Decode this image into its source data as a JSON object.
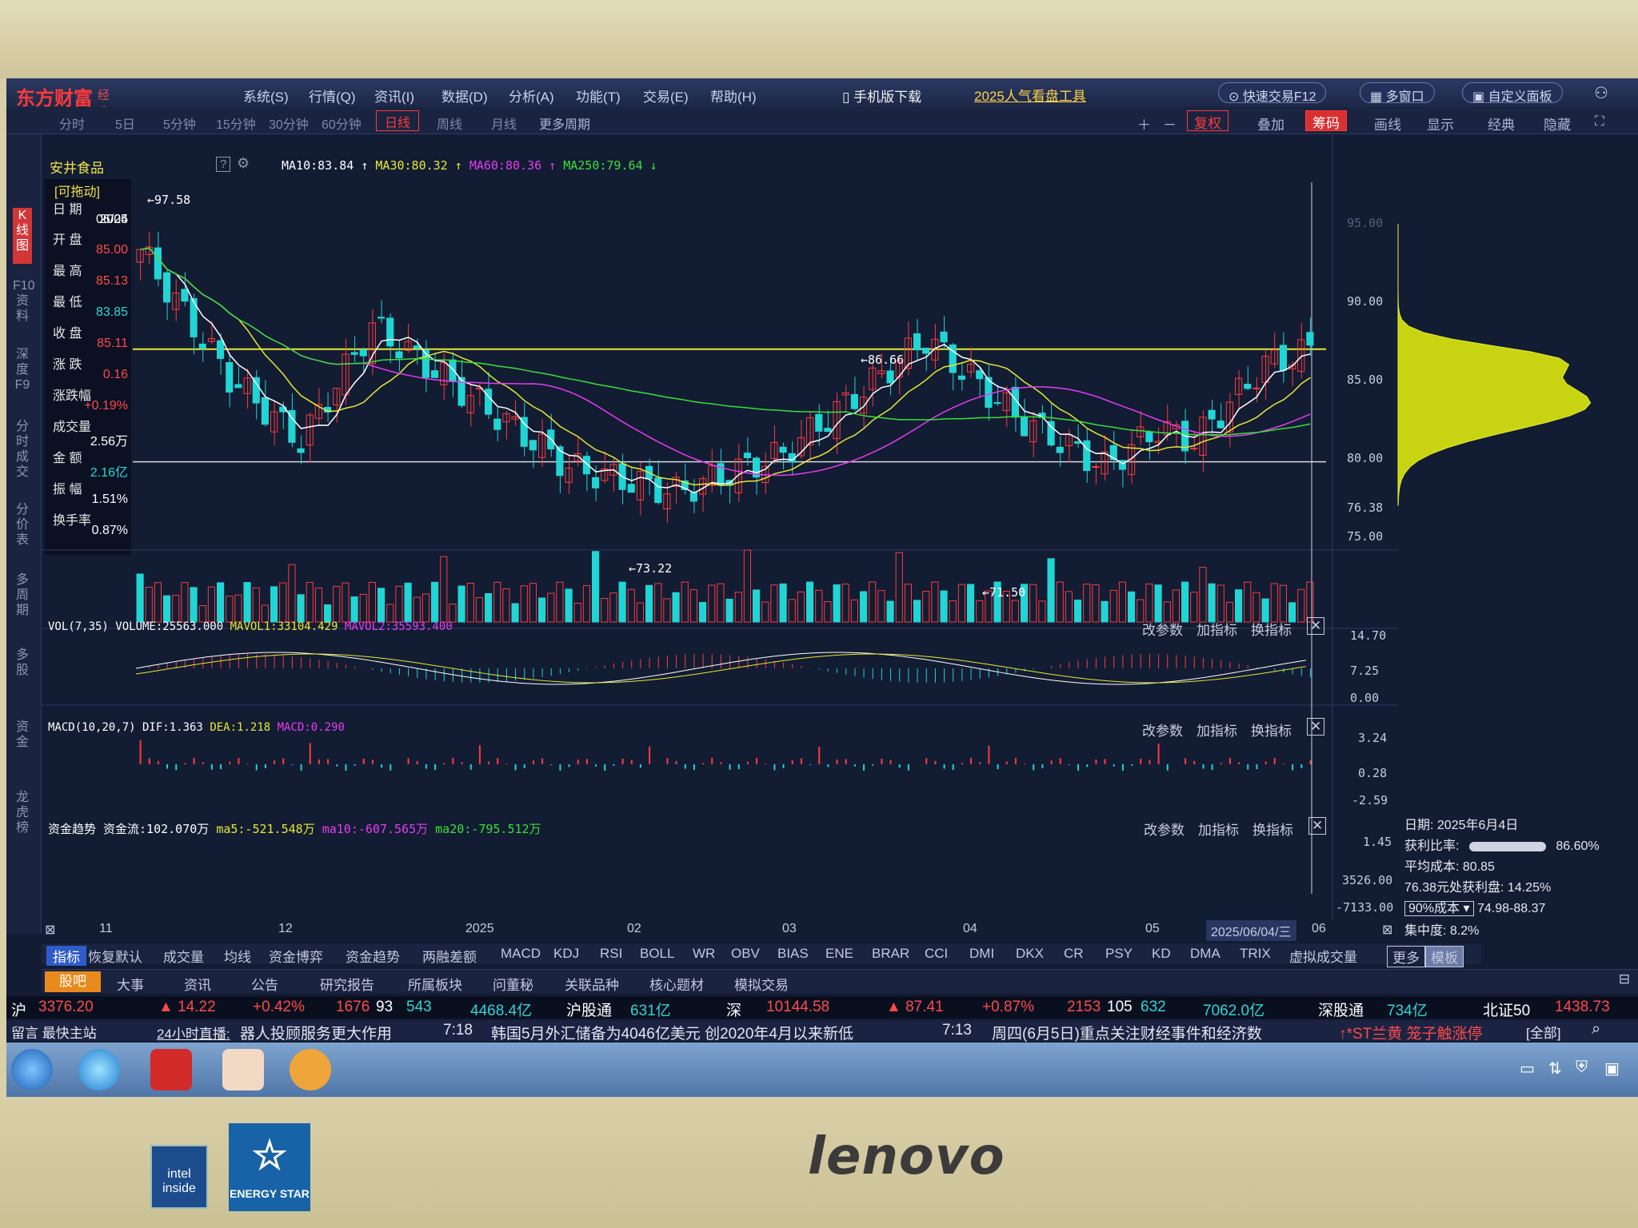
{
  "app": {
    "logo": "东方财富",
    "edition": "经典版"
  },
  "menu": [
    "系统(S)",
    "行情(Q)",
    "资讯(I)",
    "数据(D)",
    "分析(A)",
    "功能(T)",
    "交易(E)",
    "帮助(H)"
  ],
  "phone_btn": "手机版下载",
  "promo": "2025人气看盘工具",
  "pills": [
    "快速交易F12",
    "多窗口",
    "自定义面板"
  ],
  "periods": [
    "分时",
    "5日",
    "5分钟",
    "15分钟",
    "30分钟",
    "60分钟",
    "日线",
    "周线",
    "月线",
    "更多周期"
  ],
  "active_period": "日线",
  "tools": [
    "复权",
    "叠加",
    "筹码",
    "画线",
    "显示",
    "经典",
    "隐藏"
  ],
  "side_tabs": [
    "K线图",
    "F10资料",
    "深度F9",
    "分时成交",
    "分价表",
    "多周期",
    "多股",
    "资金",
    "龙虎榜"
  ],
  "stock": {
    "name": "安井食品"
  },
  "info": {
    "draggable": "[可拖动]",
    "rows": [
      {
        "label": "日  期",
        "value": "2025"
      },
      {
        "label": "",
        "value": "06/04"
      },
      {
        "label": "开  盘",
        "value": "85.00"
      },
      {
        "label": "最  高",
        "value": "85.13"
      },
      {
        "label": "最  低",
        "value": "83.85"
      },
      {
        "label": "收  盘",
        "value": "85.11"
      },
      {
        "label": "涨  跌",
        "value": "0.16"
      },
      {
        "label": "涨跌幅",
        "value": "+0.19%"
      },
      {
        "label": "成交量",
        "value": "2.56万"
      },
      {
        "label": "金  额",
        "value": "2.16亿"
      },
      {
        "label": "振  幅",
        "value": "1.51%"
      },
      {
        "label": "换手率",
        "value": "0.87%"
      }
    ]
  },
  "ma_legend": {
    "ma10": "MA10:83.84",
    "ma30": "MA30:80.32",
    "ma60": "MA60:80.36",
    "ma250": "MA250:79.64"
  },
  "price_labels": {
    "high": "97.58",
    "mid_high": "86.66",
    "low1": "73.22",
    "low2": "71.50"
  },
  "price_axis": [
    "95.00",
    "90.00",
    "85.00",
    "80.00",
    "76.38",
    "75.00"
  ],
  "panel_buttons": [
    "改参数",
    "加指标",
    "换指标"
  ],
  "vol": {
    "legend": "VOL(7,35)  VOLUME:25563.000",
    "mavol1": "MAVOL1:33104.429",
    "mavol2": "MAVOL2:35593.400",
    "axis": [
      "14.70",
      "7.25",
      "0.00"
    ]
  },
  "macd": {
    "legend": "MACD(10,20,7)  DIF:1.363",
    "dea": "DEA:1.218",
    "macd": "MACD:0.290",
    "axis": [
      "3.24",
      "0.28",
      "-2.59"
    ]
  },
  "flow": {
    "legend": "资金趋势  资金流:102.070万",
    "ma5": "ma5:-521.548万",
    "ma10": "ma10:-607.565万",
    "ma20": "ma20:-795.512万",
    "axis": [
      "1.45",
      "3526.00",
      "-7133.00"
    ]
  },
  "x_axis": [
    "11",
    "12",
    "2025",
    "02",
    "03",
    "04",
    "05",
    "2025/06/04/三",
    "06"
  ],
  "chip": {
    "date": "日期: 2025年6月4日",
    "profit_label": "获利比率:",
    "profit_value": "86.60%",
    "avg_cost": "平均成本: 80.85",
    "profit_at": "76.38元处获利盘: 14.25%",
    "cost_select": "90%成本",
    "cost_range": "74.98-88.37",
    "concentration": "集中度: 8.2%"
  },
  "indicator_tabs": [
    "指标",
    "恢复默认",
    "成交量",
    "均线",
    "资金博弈",
    "资金趋势",
    "两融差额",
    "MACD",
    "KDJ",
    "RSI",
    "BOLL",
    "WR",
    "OBV",
    "BIAS",
    "ENE",
    "BRAR",
    "CCI",
    "DMI",
    "DKX",
    "CR",
    "PSY",
    "KD",
    "DMA",
    "TRIX",
    "虚拟成交量",
    "更多",
    "模板"
  ],
  "sub_tabs": [
    "股吧",
    "大事",
    "资讯",
    "公告",
    "研究报告",
    "所属板块",
    "问董秘",
    "关联品种",
    "核心题材",
    "模拟交易"
  ],
  "ticker": {
    "sh_label": "沪",
    "sh_index": "3376.20",
    "sh_chg": "▲ 14.22",
    "sh_pct": "+0.42%",
    "sh_up": "1676",
    "sh_flat": "93",
    "sh_down": "543",
    "sh_amt": "4468.4亿",
    "hgt": "沪股通",
    "hgt_val": "631亿",
    "sz_label": "深",
    "sz_index": "10144.58",
    "sz_chg": "▲ 87.41",
    "sz_pct": "+0.87%",
    "sz_up": "2153",
    "sz_flat": "105",
    "sz_down": "632",
    "sz_amt": "7062.0亿",
    "sgt": "深股通",
    "sgt_val": "734亿",
    "bz_label": "北证50",
    "bz_val": "1438.73"
  },
  "news": {
    "left": "留言  最快主站",
    "live": "24小时直播:",
    "item1": "器人投顾服务更大作用",
    "time1": "7:18",
    "item2": "韩国5月外汇储备为4046亿美元 创2020年4月以来新低",
    "time2": "7:13",
    "item3": "周四(6月5日)重点关注财经事件和经济数",
    "alert": "↑*ST兰黄  笼子触涨停",
    "all": "[全部]"
  },
  "monitor": {
    "brand": "lenovo",
    "intel": "intel inside",
    "energy": "ENERGY STAR"
  },
  "colors": {
    "up": "#ff3b3b",
    "down": "#21d5d5",
    "ma10": "#ffffff",
    "ma30": "#e8e832",
    "ma60": "#e63cf0",
    "ma250": "#38e038",
    "accent": "#ff3a3a"
  }
}
